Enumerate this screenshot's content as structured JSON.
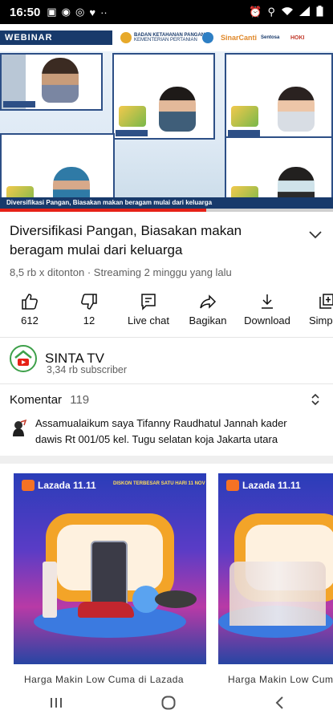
{
  "status_bar": {
    "time": "16:50"
  },
  "video": {
    "tag": "WEBINAR",
    "sponsor1": "BADAN KETAHANAN PANGAN",
    "sponsor1_sub": "KEMENTERIAN PERTANIAN",
    "sponsor2": "SinarCanti",
    "sponsor3": "Sentosa",
    "sponsor4": "HOKI",
    "strip_text": "Diversifikasi Pangan, Biasakan makan beragam mulai dari keluarga",
    "progress": 0.62
  },
  "details": {
    "title": "Diversifikasi Pangan, Biasakan makan beragam mulai dari keluarga",
    "meta": "8,5 rb x ditonton · Streaming 2 minggu yang lalu"
  },
  "actions": [
    {
      "icon": "like-icon",
      "label": "612"
    },
    {
      "icon": "dislike-icon",
      "label": "12"
    },
    {
      "icon": "live-chat-icon",
      "label": "Live chat"
    },
    {
      "icon": "share-icon",
      "label": "Bagikan"
    },
    {
      "icon": "download-icon",
      "label": "Download"
    },
    {
      "icon": "save-icon",
      "label": "Simpan"
    }
  ],
  "channel": {
    "name": "SINTA TV",
    "subscribers": "3,34 rb subscriber"
  },
  "comments": {
    "label": "Komentar",
    "count": "119",
    "top_comment": "Assamualaikum saya Tifanny Raudhatul Jannah kader dawis Rt 001/05 kel. Tugu selatan koja Jakarta utara"
  },
  "ads": [
    {
      "brand": "Lazada 11.11",
      "promo": "DISKON TERBESAR SATU HARI 11 NOV",
      "caption": "Harga Makin Low Cuma di Lazada"
    },
    {
      "brand": "Lazada 11.11",
      "promo": "",
      "caption": "Harga Makin Low Cuma di Lazada"
    }
  ]
}
